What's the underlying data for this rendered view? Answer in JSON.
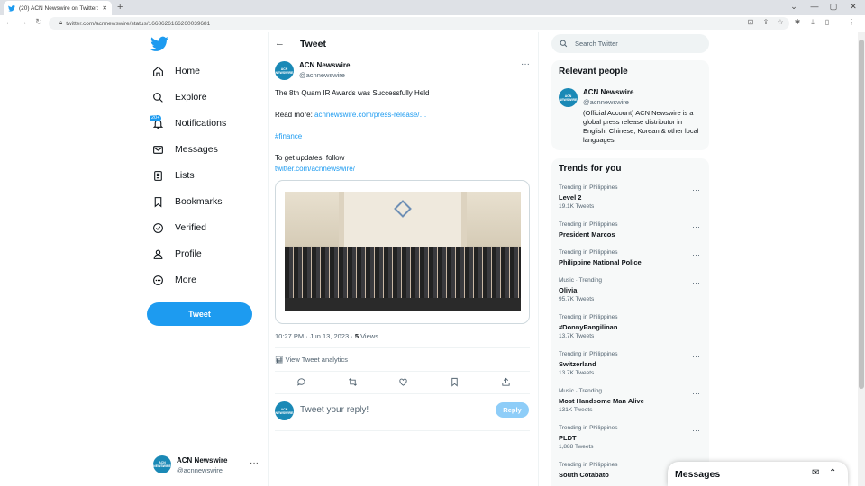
{
  "browser": {
    "tab_title": "(20) ACN Newswire on Twitter: \"T",
    "url": "twitter.com/acnnewswire/status/1668626166260039681",
    "icons": [
      "twitter-icon",
      "close-icon",
      "plus-icon",
      "back-arrow-icon",
      "forward-arrow-icon",
      "reload-icon",
      "lock-icon",
      "install-icon",
      "share-icon",
      "star-icon",
      "extensions-icon",
      "download-icon",
      "sidebar-icon",
      "menu-icon",
      "minimize-icon",
      "maximize-icon",
      "chevron-down-icon"
    ]
  },
  "sidebar": {
    "items": [
      {
        "label": "Home",
        "icon": "home-icon"
      },
      {
        "label": "Explore",
        "icon": "search-icon"
      },
      {
        "label": "Notifications",
        "icon": "bell-icon",
        "badge": "20+"
      },
      {
        "label": "Messages",
        "icon": "envelope-icon"
      },
      {
        "label": "Lists",
        "icon": "list-icon"
      },
      {
        "label": "Bookmarks",
        "icon": "bookmark-icon"
      },
      {
        "label": "Verified",
        "icon": "verified-icon"
      },
      {
        "label": "Profile",
        "icon": "person-icon"
      },
      {
        "label": "More",
        "icon": "more-circle-icon"
      }
    ],
    "tweet_button": "Tweet",
    "account": {
      "name": "ACN Newswire",
      "handle": "@acnnewswire"
    }
  },
  "main": {
    "title": "Tweet",
    "tweet": {
      "author": "ACN Newswire",
      "handle": "@acnnewswire",
      "avatar_text": "ACN NEWSWIRE",
      "line1": "The 8th Quam IR Awards was Successfully Held",
      "read_more_label": "Read more:",
      "read_more_link": "acnnewswire.com/press-release/…",
      "hashtag": "#finance",
      "follow_text": "To get updates, follow",
      "follow_link": "twitter.com/acnnewswire/",
      "time": "10:27 PM · Jun 13, 2023 · ",
      "views_count": "5",
      "views_label": " Views",
      "analytics": "View Tweet analytics"
    },
    "reply": {
      "placeholder": "Tweet your reply!",
      "button": "Reply"
    }
  },
  "right": {
    "search_placeholder": "Search Twitter",
    "relevant": {
      "title": "Relevant people",
      "name": "ACN Newswire",
      "handle": "@acnnewswire",
      "bio": "(Official Account) ACN Newswire is a global press release distributor in English, Chinese, Korean & other local languages."
    },
    "trends_title": "Trends for you",
    "trends": [
      {
        "category": "Trending in Philippines",
        "name": "Level 2",
        "count": "19.1K Tweets"
      },
      {
        "category": "Trending in Philippines",
        "name": "President Marcos",
        "count": ""
      },
      {
        "category": "Trending in Philippines",
        "name": "Philippine National Police",
        "count": ""
      },
      {
        "category": "Music · Trending",
        "name": "Olivia",
        "count": "95.7K Tweets"
      },
      {
        "category": "Trending in Philippines",
        "name": "#DonnyPangilinan",
        "count": "13.7K Tweets"
      },
      {
        "category": "Trending in Philippines",
        "name": "Switzerland",
        "count": "13.7K Tweets"
      },
      {
        "category": "Music · Trending",
        "name": "Most Handsome Man Alive",
        "count": "131K Tweets"
      },
      {
        "category": "Trending in Philippines",
        "name": "PLDT",
        "count": "1,888 Tweets"
      },
      {
        "category": "Trending in Philippines",
        "name": "South Cotabato",
        "count": ""
      }
    ]
  },
  "drawer": {
    "title": "Messages"
  },
  "colors": {
    "accent": "#1d9bf0",
    "reply_disabled": "#8ecdf8",
    "avatar": "#1a89b6"
  }
}
